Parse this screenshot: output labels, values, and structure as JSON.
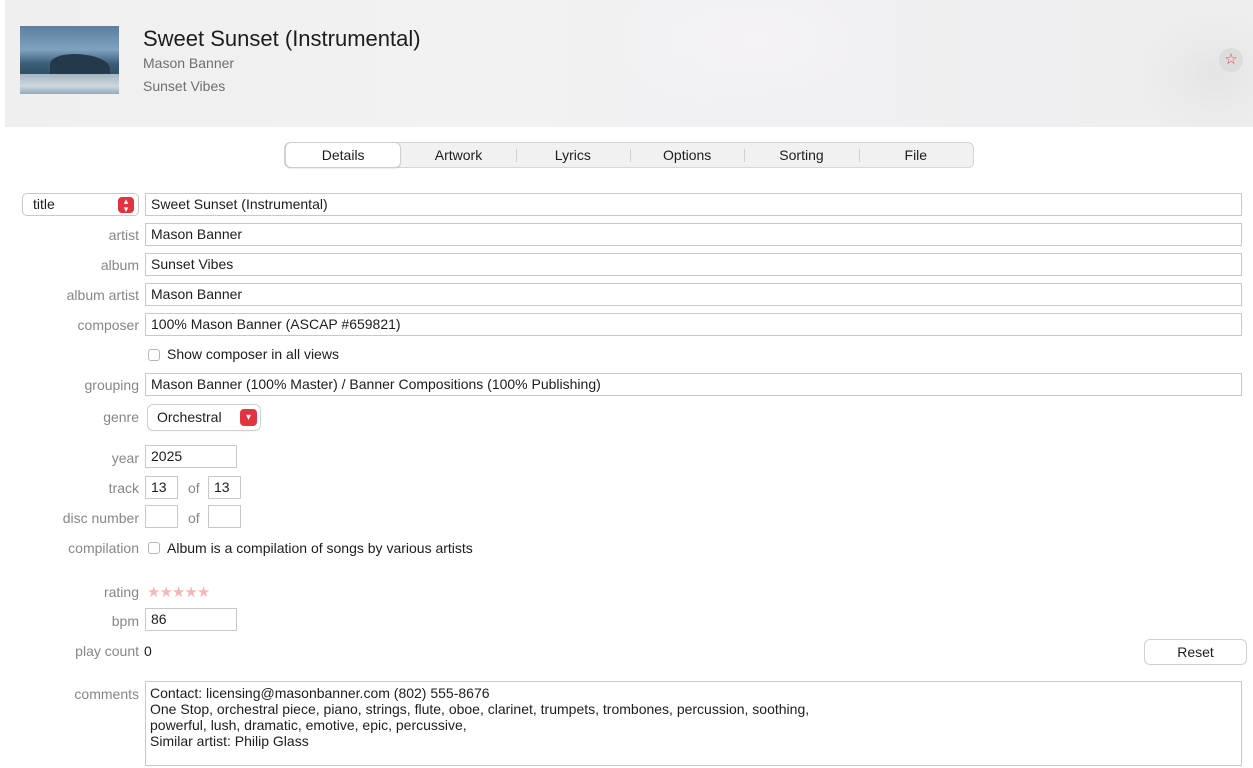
{
  "header": {
    "title": "Sweet Sunset (Instrumental)",
    "artist": "Mason Banner",
    "album": "Sunset Vibes",
    "love_icon": "star-icon"
  },
  "tabs": [
    {
      "label": "Details",
      "active": true
    },
    {
      "label": "Artwork",
      "active": false
    },
    {
      "label": "Lyrics",
      "active": false
    },
    {
      "label": "Options",
      "active": false
    },
    {
      "label": "Sorting",
      "active": false
    },
    {
      "label": "File",
      "active": false
    }
  ],
  "fields": {
    "title_popup": "title",
    "title": "Sweet Sunset (Instrumental)",
    "artist_label": "artist",
    "artist": "Mason Banner",
    "album_label": "album",
    "album": "Sunset Vibes",
    "album_artist_label": "album artist",
    "album_artist": "Mason Banner",
    "composer_label": "composer",
    "composer": "100% Mason Banner (ASCAP #659821)",
    "show_composer_label": "Show composer in all views",
    "show_composer_checked": false,
    "grouping_label": "grouping",
    "grouping": "Mason Banner (100% Master) / Banner Compositions (100% Publishing)",
    "genre_label": "genre",
    "genre": "Orchestral",
    "year_label": "year",
    "year": "2025",
    "track_label": "track",
    "track": "13",
    "of_label": "of",
    "track_total": "13",
    "disc_label": "disc number",
    "disc": "",
    "disc_total": "",
    "compilation_label": "compilation",
    "compilation_text": "Album is a compilation of songs by various artists",
    "compilation_checked": false,
    "rating_label": "rating",
    "rating_value": 0,
    "rating_max": 5,
    "bpm_label": "bpm",
    "bpm": "86",
    "play_count_label": "play count",
    "play_count": "0",
    "reset_label": "Reset",
    "comments_label": "comments",
    "comments": [
      "Contact: licensing@masonbanner.com (802) 555-8676",
      "One Stop, orchestral piece, piano, strings, flute, oboe, clarinet, trumpets, trombones, percussion, soothing,",
      "powerful, lush, dramatic, emotive, epic, percussive,",
      "Similar artist: Philip Glass"
    ]
  },
  "colors": {
    "accent": "#e0343e",
    "label": "#86868b",
    "rating_star": "#f4b6b9"
  }
}
